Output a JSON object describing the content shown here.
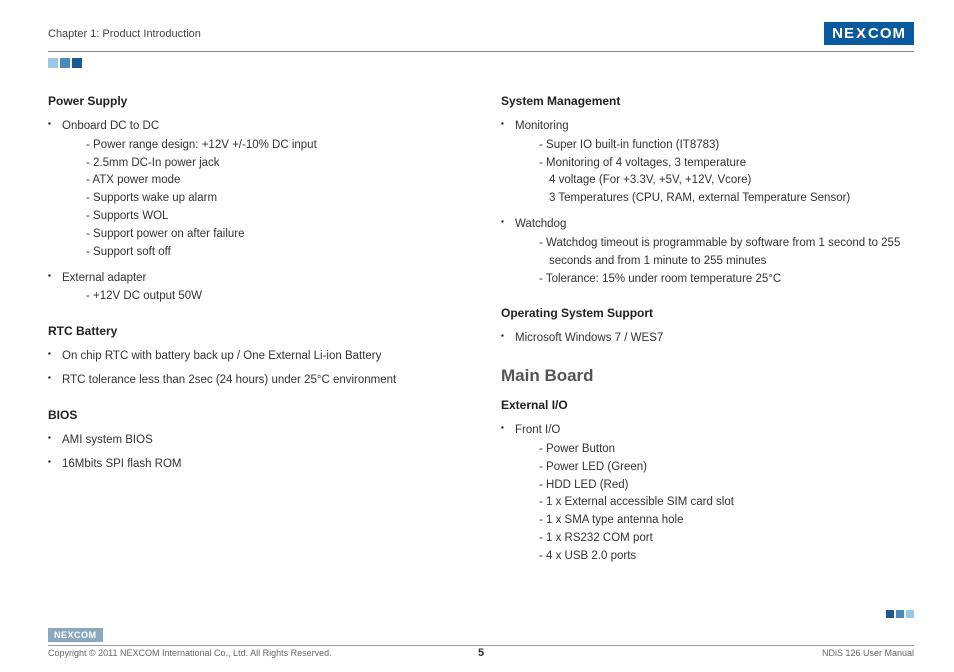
{
  "header": {
    "chapter": "Chapter 1: Product Introduction",
    "brand": "NEXCOM"
  },
  "left": {
    "power_supply": {
      "title": "Power Supply",
      "items": [
        {
          "label": "Onboard DC to DC",
          "sub": [
            "- Power range design: +12V +/-10% DC input",
            "- 2.5mm DC-In power jack",
            "- ATX power mode",
            "- Supports wake up alarm",
            "- Supports WOL",
            "- Support power on after failure",
            "- Support soft off"
          ]
        },
        {
          "label": "External adapter",
          "sub": [
            "- +12V DC output 50W"
          ]
        }
      ]
    },
    "rtc": {
      "title": "RTC Battery",
      "items": [
        "On chip RTC with battery back up / One External Li-ion Battery",
        "RTC tolerance less than 2sec (24 hours) under 25°C environment"
      ]
    },
    "bios": {
      "title": "BIOS",
      "items": [
        "AMI system BIOS",
        "16Mbits SPI flash ROM"
      ]
    }
  },
  "right": {
    "sysmgmt": {
      "title": "System Management",
      "monitoring": {
        "label": "Monitoring",
        "sub": [
          "- Super IO built-in function (IT8783)",
          "- Monitoring of 4 voltages, 3 temperature"
        ],
        "indent": [
          "4 voltage (For +3.3V, +5V, +12V, Vcore)",
          "3 Temperatures (CPU, RAM, external Temperature Sensor)"
        ]
      },
      "watchdog": {
        "label": "Watchdog",
        "sub1a": "- Watchdog timeout is programmable by software from 1 second to 255",
        "sub1b": "seconds and from 1 minute to 255 minutes",
        "sub2": "- Tolerance: 15% under room temperature 25°C"
      }
    },
    "os": {
      "title": "Operating System Support",
      "items": [
        "Microsoft Windows 7 / WES7"
      ]
    },
    "mainboard": {
      "heading": "Main Board",
      "extio": {
        "title": "External I/O",
        "label": "Front I/O",
        "sub": [
          "- Power Button",
          "- Power LED (Green)",
          "- HDD LED (Red)",
          "- 1 x External accessible SIM card slot",
          "- 1 x SMA type antenna hole",
          "- 1 x RS232 COM port",
          "- 4 x USB 2.0 ports"
        ]
      }
    }
  },
  "footer": {
    "brand": "NEXCOM",
    "copyright": "Copyright © 2011 NEXCOM International Co., Ltd. All Rights Reserved.",
    "page": "5",
    "doc": "NDiS 126 User Manual"
  }
}
